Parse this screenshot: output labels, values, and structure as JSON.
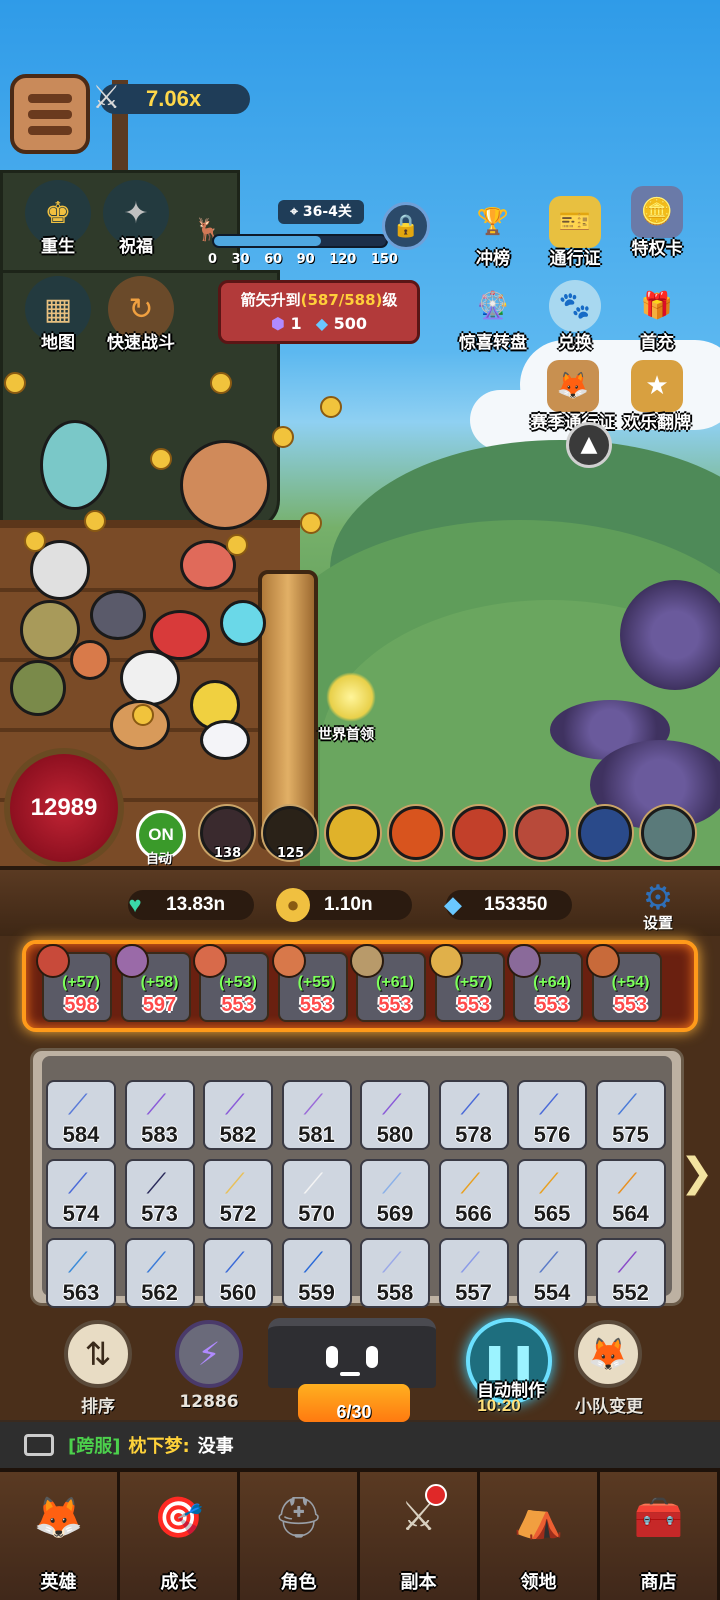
{
  "hud": {
    "multiplier": "7.06x",
    "left_buttons": [
      {
        "label": "重生",
        "icon": "rebirth-icon"
      },
      {
        "label": "祝福",
        "icon": "blessing-icon"
      },
      {
        "label": "地图",
        "icon": "map-icon"
      },
      {
        "label": "快速战斗",
        "icon": "quick-battle-icon"
      }
    ],
    "stage": {
      "label": "36-4关",
      "ticks": [
        "0",
        "30",
        "60",
        "90",
        "120",
        "150"
      ],
      "progress": 0.62
    },
    "quest": {
      "text_prefix": "箭矢升到",
      "text_highlight": "(587/588)",
      "text_suffix": "级",
      "reward_token": "1",
      "reward_gems": "500"
    },
    "right_icons_row1": [
      {
        "label": "冲榜",
        "icon": "ranking-trophy-icon"
      },
      {
        "label": "通行证",
        "icon": "pass-card-icon"
      },
      {
        "label": "特权卡",
        "icon": "privilege-card-icon"
      }
    ],
    "right_icons_row2": [
      {
        "label": "惊喜转盘",
        "icon": "surprise-wheel-icon"
      },
      {
        "label": "兑换",
        "icon": "exchange-icon"
      },
      {
        "label": "首充",
        "icon": "first-recharge-icon"
      }
    ],
    "season_label": "赛季通行证",
    "flip_label": "欢乐翻牌",
    "boss_label": "世界首领",
    "power": "12989",
    "auto_toggle": "ON",
    "auto_label": "自动",
    "skills": [
      {
        "icon": "red-devil-skill-icon",
        "count": "138",
        "color": "#3a2a2e"
      },
      {
        "icon": "dark-rider-skill-icon",
        "count": "125",
        "color": "#2a2218"
      },
      {
        "icon": "bee-skill-icon",
        "count": "",
        "color": "#e0b22a"
      },
      {
        "icon": "fire-skill-icon",
        "count": "",
        "color": "#d8541e"
      },
      {
        "icon": "meteor-skill-icon",
        "count": "",
        "color": "#c2402a"
      },
      {
        "icon": "wolf-skill-icon",
        "count": "",
        "color": "#b84a3a"
      },
      {
        "icon": "ice-skill-icon",
        "count": "",
        "color": "#2a4a8a"
      },
      {
        "icon": "slash-skill-icon",
        "count": "",
        "color": "#5a7a7a"
      }
    ]
  },
  "resources": {
    "hearts": "13.83n",
    "gold": "1.10n",
    "diamonds": "153350",
    "settings_label": "设置"
  },
  "hot_slots": [
    {
      "plus": "(+57)",
      "level": "598",
      "avatar_color": "#c84a3a"
    },
    {
      "plus": "(+58)",
      "level": "597",
      "avatar_color": "#9a6aa8"
    },
    {
      "plus": "(+53)",
      "level": "553",
      "avatar_color": "#d86a4a"
    },
    {
      "plus": "(+55)",
      "level": "553",
      "avatar_color": "#d8784a"
    },
    {
      "plus": "(+61)",
      "level": "553",
      "avatar_color": "#b89a6a"
    },
    {
      "plus": "(+57)",
      "level": "553",
      "avatar_color": "#e0b04a"
    },
    {
      "plus": "(+64)",
      "level": "553",
      "avatar_color": "#8a6a9a"
    },
    {
      "plus": "(+54)",
      "level": "553",
      "avatar_color": "#c86a3a"
    }
  ],
  "weapons": [
    {
      "level": "584",
      "color": "#5a7ad8"
    },
    {
      "level": "583",
      "color": "#8a5ad8"
    },
    {
      "level": "582",
      "color": "#8a5ad8"
    },
    {
      "level": "581",
      "color": "#9a6ad8"
    },
    {
      "level": "580",
      "color": "#8a5ad8"
    },
    {
      "level": "578",
      "color": "#4a6ad8"
    },
    {
      "level": "576",
      "color": "#4a6ad8"
    },
    {
      "level": "575",
      "color": "#4a7ad8"
    },
    {
      "level": "574",
      "color": "#4a6ad8"
    },
    {
      "level": "573",
      "color": "#2a2a5a"
    },
    {
      "level": "572",
      "color": "#e8c05a"
    },
    {
      "level": "570",
      "color": "#f4f4f4"
    },
    {
      "level": "569",
      "color": "#8ab0e8"
    },
    {
      "level": "566",
      "color": "#e8a020"
    },
    {
      "level": "565",
      "color": "#e8a020"
    },
    {
      "level": "564",
      "color": "#e89020"
    },
    {
      "level": "563",
      "color": "#3a8ad8"
    },
    {
      "level": "562",
      "color": "#3a7ad8"
    },
    {
      "level": "560",
      "color": "#3a6ad8"
    },
    {
      "level": "559",
      "color": "#2a6ad8"
    },
    {
      "level": "558",
      "color": "#9aa8e8"
    },
    {
      "level": "557",
      "color": "#8a9ae8"
    },
    {
      "level": "554",
      "color": "#5a7ac8"
    },
    {
      "level": "552",
      "color": "#8a4ac8"
    }
  ],
  "controls": {
    "sort_label": "排序",
    "energy_value": "12886",
    "anvil_count": "6/30",
    "auto_make_label": "自动制作",
    "auto_make_time": "10:20",
    "squad_label": "小队变更"
  },
  "chat": {
    "channel": "[跨服]",
    "name": "枕下梦:",
    "message": "没事"
  },
  "nav": [
    {
      "label": "英雄",
      "icon": "hero-fox-icon",
      "color": "#d8a050"
    },
    {
      "label": "成长",
      "icon": "growth-target-icon",
      "color": "#c89a6a"
    },
    {
      "label": "角色",
      "icon": "knight-helmet-icon",
      "color": "#9aa0a8"
    },
    {
      "label": "副本",
      "icon": "crossed-swords-icon",
      "color": "#d8d0c0"
    },
    {
      "label": "领地",
      "icon": "territory-tent-icon",
      "color": "#c8a070"
    },
    {
      "label": "商店",
      "icon": "shop-chest-icon",
      "color": "#8a6ac8"
    }
  ]
}
